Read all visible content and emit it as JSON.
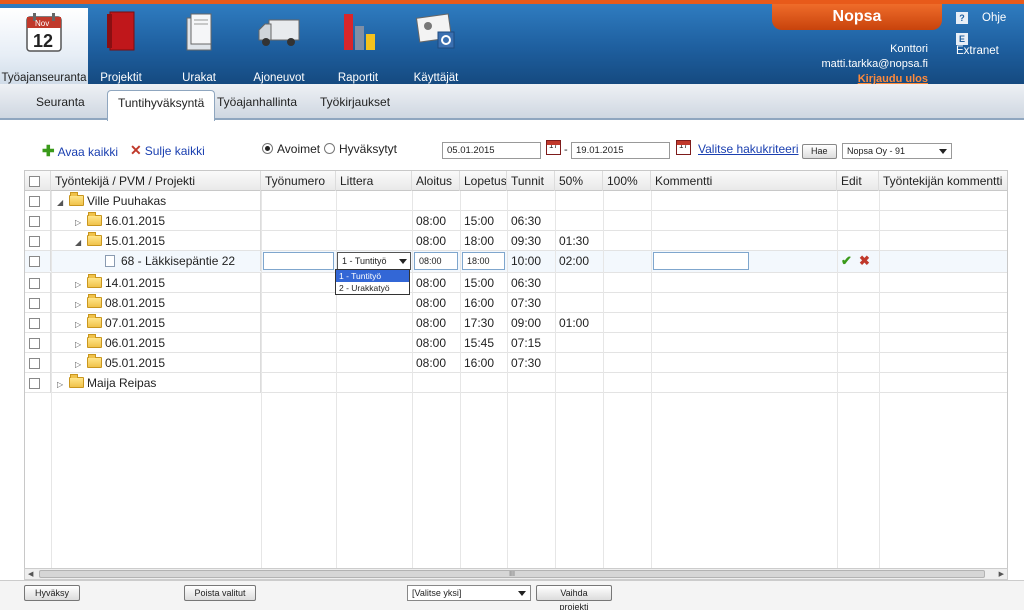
{
  "nav": {
    "items": [
      {
        "label": "Työajanseuranta",
        "icon": "calendar-icon",
        "cal_month": "Nov",
        "cal_day": "12"
      },
      {
        "label": "Projektit",
        "icon": "binder-icon"
      },
      {
        "label": "Urakat",
        "icon": "folders-icon"
      },
      {
        "label": "Ajoneuvot",
        "icon": "truck-icon"
      },
      {
        "label": "Raportit",
        "icon": "bar-chart-icon"
      },
      {
        "label": "Käyttäjät",
        "icon": "user-card-icon"
      }
    ]
  },
  "brand": "Nopsa",
  "user": {
    "role": "Konttori",
    "email": "matti.tarkka@nopsa.fi",
    "logout": "Kirjaudu ulos"
  },
  "side_links": [
    {
      "label": "Ohje",
      "icon_char": "?"
    },
    {
      "label": "Extranet",
      "icon_char": "E"
    }
  ],
  "tabs": [
    "Seuranta",
    "Tuntihyväksyntä",
    "Työajanhallinta",
    "Työkirjaukset"
  ],
  "toolbar": {
    "open_all": "Avaa kaikki",
    "close_all": "Sulje kaikki",
    "radio_open": "Avoimet",
    "radio_approved": "Hyväksytyt",
    "date_from": "05.01.2015",
    "date_sep": "-",
    "date_to": "19.01.2015",
    "cal_day": "17",
    "criteria_link": "Valitse hakukriteeri",
    "search_btn": "Hae",
    "company": "Nopsa Oy - 91"
  },
  "columns": [
    "Työntekijä / PVM / Projekti",
    "Työnumero",
    "Littera",
    "Aloitus",
    "Lopetus",
    "Tunnit",
    "50%",
    "100%",
    "Kommentti",
    "Edit",
    "Työntekijän kommentti"
  ],
  "rows": [
    {
      "label": "Ville Puuhakas",
      "level": 0,
      "expanded": true,
      "type": "folder",
      "start": "",
      "end": "",
      "hours": "",
      "p50": ""
    },
    {
      "label": "16.01.2015",
      "level": 1,
      "expanded": false,
      "type": "folder",
      "start": "08:00",
      "end": "15:00",
      "hours": "06:30",
      "p50": ""
    },
    {
      "label": "15.01.2015",
      "level": 1,
      "expanded": true,
      "type": "folder",
      "start": "08:00",
      "end": "18:00",
      "hours": "09:30",
      "p50": "01:30"
    },
    {
      "label": "68 - Läkkisepäntie 22",
      "level": 2,
      "expanded": false,
      "type": "doc",
      "start": "08:00",
      "end": "18:00",
      "hours": "10:00",
      "p50": "02:00"
    },
    {
      "label": "14.01.2015",
      "level": 1,
      "expanded": false,
      "type": "folder",
      "start": "08:00",
      "end": "15:00",
      "hours": "06:30",
      "p50": ""
    },
    {
      "label": "08.01.2015",
      "level": 1,
      "expanded": false,
      "type": "folder",
      "start": "08:00",
      "end": "16:00",
      "hours": "07:30",
      "p50": ""
    },
    {
      "label": "07.01.2015",
      "level": 1,
      "expanded": false,
      "type": "folder",
      "start": "08:00",
      "end": "17:30",
      "hours": "09:00",
      "p50": "01:00"
    },
    {
      "label": "06.01.2015",
      "level": 1,
      "expanded": false,
      "type": "folder",
      "start": "08:00",
      "end": "15:45",
      "hours": "07:15",
      "p50": ""
    },
    {
      "label": "05.01.2015",
      "level": 1,
      "expanded": false,
      "type": "folder",
      "start": "08:00",
      "end": "16:00",
      "hours": "07:30",
      "p50": ""
    },
    {
      "label": "Maija Reipas",
      "level": 0,
      "expanded": false,
      "type": "folder",
      "start": "",
      "end": "",
      "hours": "",
      "p50": ""
    }
  ],
  "edit_row": {
    "littera_selected": "1 - Tuntityö",
    "littera_options": [
      "1 - Tuntityö",
      "2 - Urakkatyö"
    ],
    "start": "08:00",
    "end": "18:00",
    "accept_icon": "check-icon",
    "cancel_icon": "x-icon"
  },
  "scroll_label": "III",
  "footer": {
    "approve": "Hyväksy",
    "remove": "Poista valitut",
    "select_placeholder": "[Valitse yksi]",
    "change_project": "Vaihda projekti"
  },
  "colors": {
    "header_blue": "#1e5f9f",
    "brand_orange": "#e0561a",
    "logout_orange": "#ff8a3a",
    "link_blue": "#1a3fb0",
    "accept_green": "#3a9a1a",
    "cancel_red": "#c0392b"
  }
}
